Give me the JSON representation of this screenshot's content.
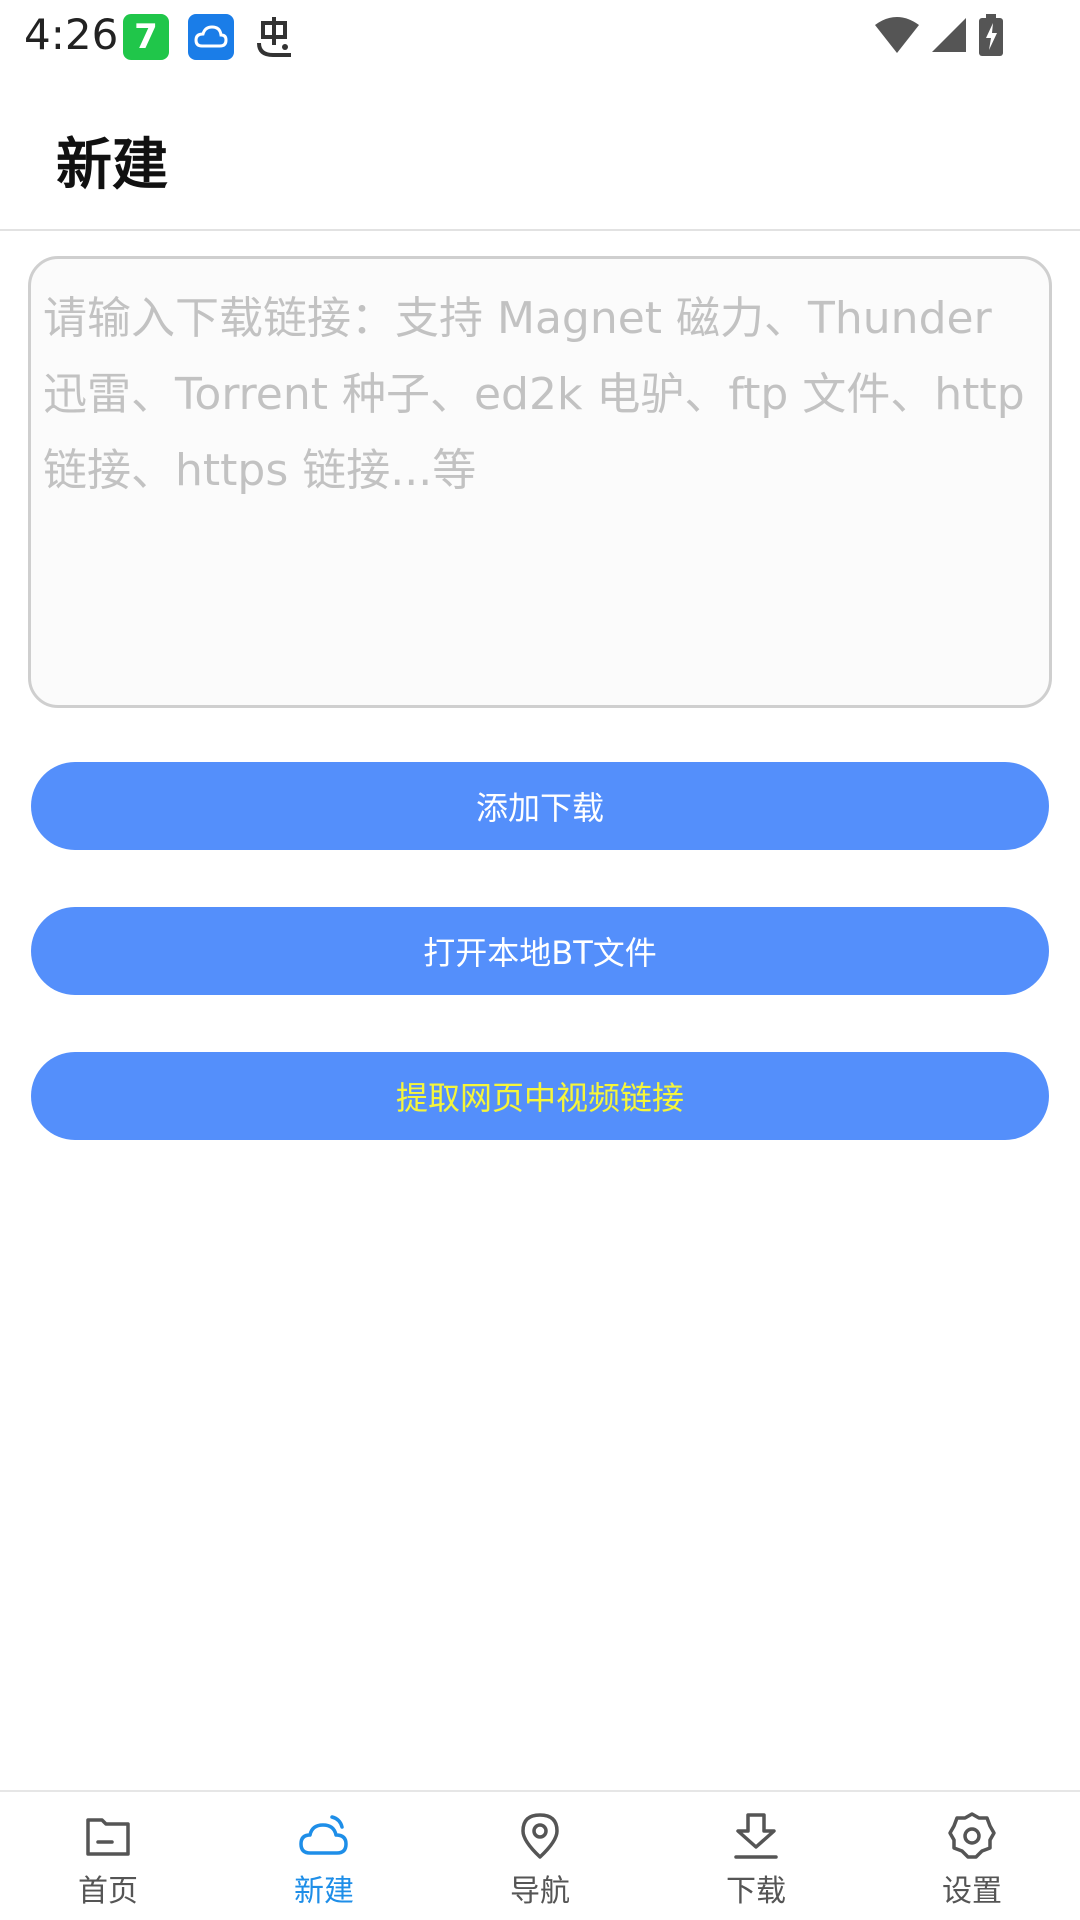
{
  "status_bar": {
    "time": "4:26",
    "app_icons": [
      "seven-app-icon",
      "cloud-app-icon",
      "bug-app-icon"
    ],
    "seven_glyph": "7",
    "right_icons": [
      "wifi-icon",
      "signal-icon",
      "battery-charging-icon"
    ]
  },
  "header": {
    "title": "新建"
  },
  "input": {
    "placeholder": "请输入下载链接：支持 Magnet 磁力、Thunder 迅雷、Torrent 种子、ed2k 电驴、ftp 文件、http 链接、https 链接...等",
    "value": ""
  },
  "buttons": {
    "add_download": "添加下载",
    "open_local_bt": "打开本地BT文件",
    "extract_video": "提取网页中视频链接"
  },
  "colors": {
    "button_bg": "#548ffb",
    "button_text": "#ffffff",
    "extract_text": "#f5f53a",
    "nav_active": "#1e8ee8",
    "nav_inactive": "#555555"
  },
  "bottom_nav": {
    "items": [
      {
        "label": "首页",
        "icon": "folder-icon",
        "active": false
      },
      {
        "label": "新建",
        "icon": "cloud-icon",
        "active": true
      },
      {
        "label": "导航",
        "icon": "location-pin-icon",
        "active": false
      },
      {
        "label": "下载",
        "icon": "download-icon",
        "active": false
      },
      {
        "label": "设置",
        "icon": "gear-icon",
        "active": false
      }
    ]
  }
}
